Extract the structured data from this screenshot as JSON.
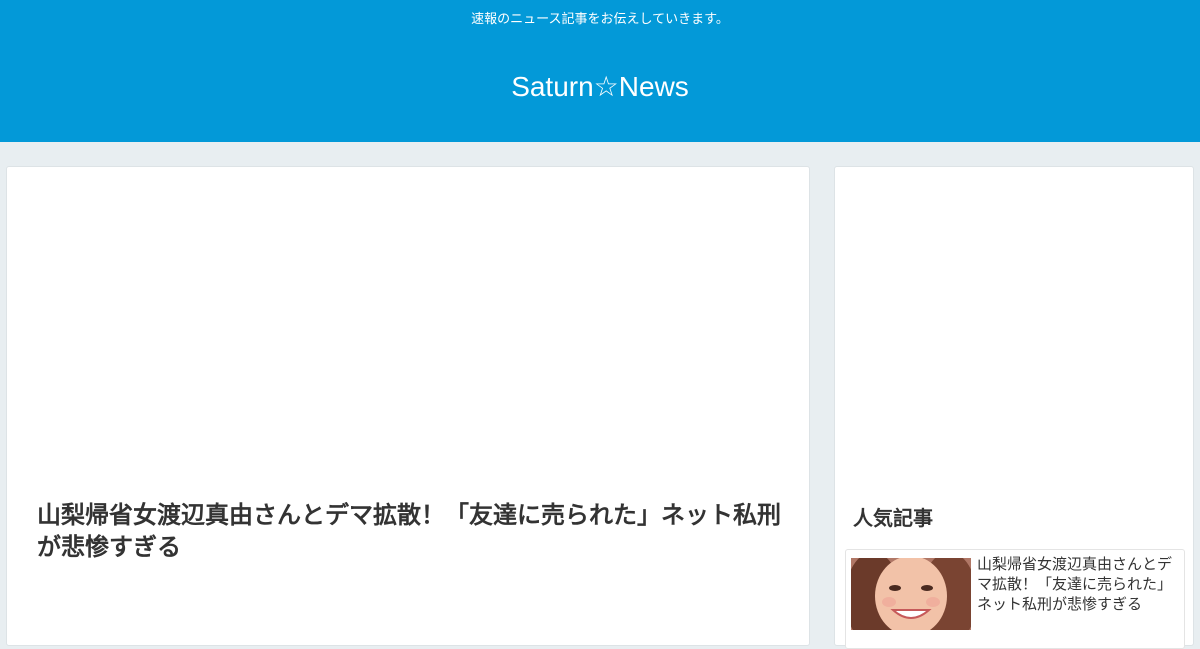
{
  "header": {
    "tagline": "速報のニュース記事をお伝えしていきます。",
    "site_title": "Saturn☆News",
    "background": "#0399d8"
  },
  "main": {
    "article_title": "山梨帰省女渡辺真由さんとデマ拡散！「友達に売られた」ネット私刑が悲惨すぎる"
  },
  "sidebar": {
    "widget_title": "人気記事",
    "popular": [
      {
        "title": "山梨帰省女渡辺真由さんとデマ拡散！「友達に売られた」ネット私刑が悲惨すぎる"
      }
    ]
  }
}
